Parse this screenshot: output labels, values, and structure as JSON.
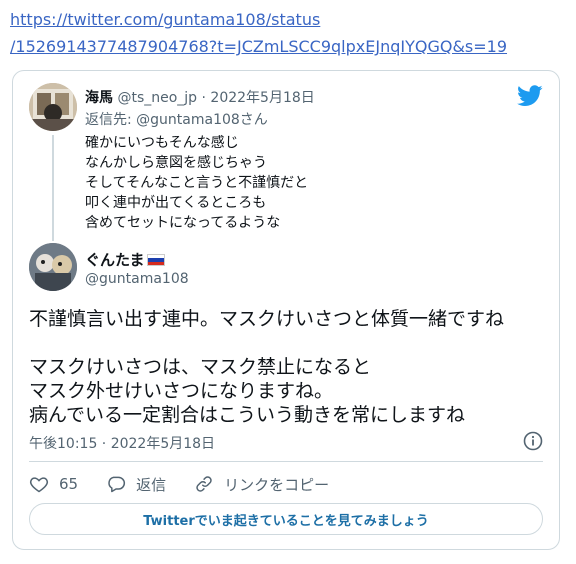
{
  "link": {
    "line1": "https://twitter.com/guntama108/status",
    "line2": "/1526914377487904768?t=JCZmLSCC9qlpxEJnqIYQGQ&s=19"
  },
  "reply": {
    "name": "海馬",
    "handle": "@ts_neo_jp",
    "date": "· 2022年5月18日",
    "reply_to": "返信先: @guntama108さん",
    "lines": [
      "確かにいつもそんな感じ",
      "なんかしら意図を感じちゃう",
      "そしてそんなこと言うと不謹慎だと",
      "叩く連中が出てくるところも",
      "含めてセットになってるような"
    ]
  },
  "tweet": {
    "name": "ぐんたま",
    "handle": "@guntama108",
    "lines": [
      "不謹慎言い出す連中。マスクけいさつと体質一緒ですね",
      "",
      "マスクけいさつは、マスク禁止になると",
      "マスク外せけいさつになりますね。",
      "病んでいる一定割合はこういう動きを常にしますね"
    ],
    "timestamp": "午後10:15 · 2022年5月18日"
  },
  "actions": {
    "like_count": "65",
    "reply_label": "返信",
    "copy_label": "リンクをコピー"
  },
  "cta_label": "Twitterでいま起きていることを見てみましょう",
  "colors": {
    "twitter_blue": "#1d9bf0",
    "link": "#3a66c4",
    "muted": "#536471",
    "border": "#cfd9de"
  },
  "icons": [
    "twitter-bird-icon",
    "info-icon",
    "heart-icon",
    "reply-icon",
    "link-icon",
    "russia-flag-icon"
  ]
}
